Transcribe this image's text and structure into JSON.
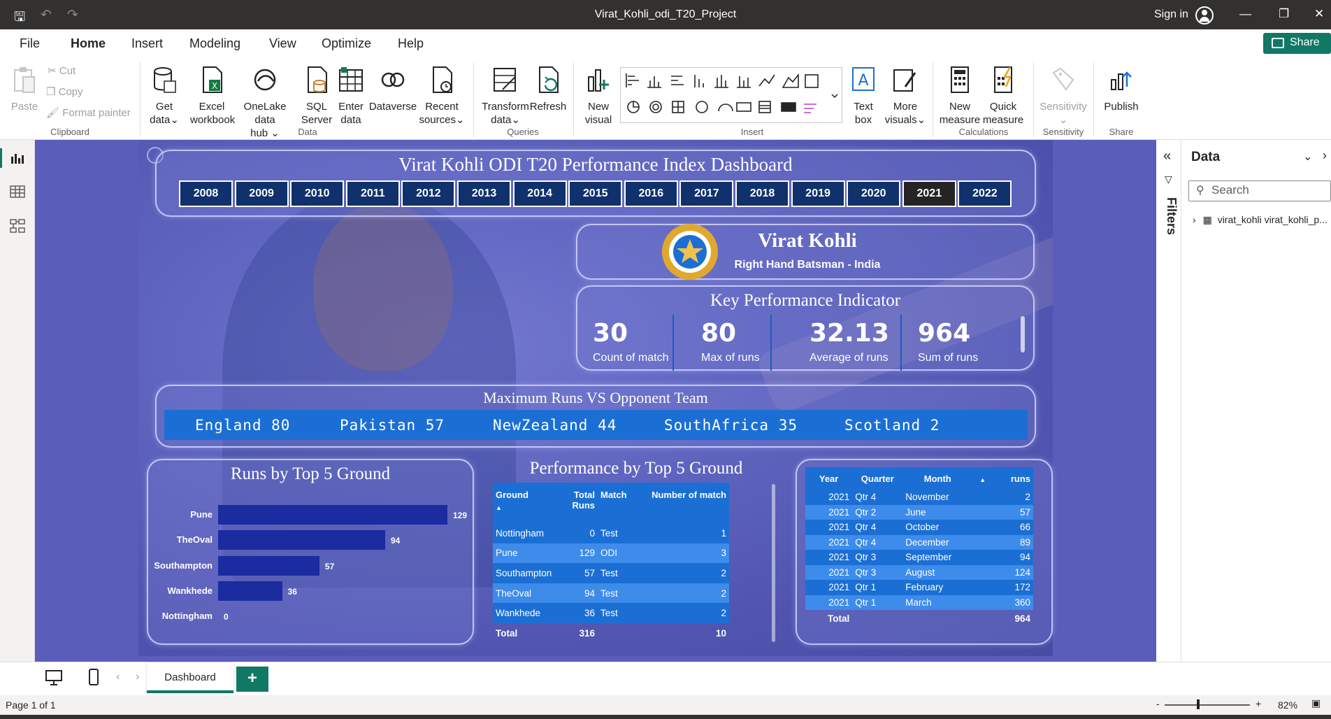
{
  "window": {
    "title": "Virat_Kohli_odi_T20_Project",
    "sign_in": "Sign in"
  },
  "menu": {
    "items": [
      "File",
      "Home",
      "Insert",
      "Modeling",
      "View",
      "Optimize",
      "Help"
    ],
    "share": "Share"
  },
  "ribbon": {
    "clipboard": {
      "paste": "Paste",
      "cut": "Cut",
      "copy": "Copy",
      "format_painter": "Format painter",
      "group": "Clipboard"
    },
    "data": {
      "get_data": [
        "Get",
        "data"
      ],
      "excel": [
        "Excel",
        "workbook"
      ],
      "onelake": [
        "OneLake data",
        "hub"
      ],
      "sql": [
        "SQL",
        "Server"
      ],
      "enter": [
        "Enter",
        "data"
      ],
      "dataverse": "Dataverse",
      "recent": [
        "Recent",
        "sources"
      ],
      "group": "Data"
    },
    "queries": {
      "transform": [
        "Transform",
        "data"
      ],
      "refresh": "Refresh",
      "group": "Queries"
    },
    "insert": {
      "new_visual": [
        "New",
        "visual"
      ],
      "text_box": [
        "Text",
        "box"
      ],
      "more_visuals": [
        "More",
        "visuals"
      ],
      "group": "Insert"
    },
    "calculations": {
      "new_measure": [
        "New",
        "measure"
      ],
      "quick_measure": [
        "Quick",
        "measure"
      ],
      "group": "Calculations"
    },
    "sensitivity": {
      "label": "Sensitivity",
      "group": "Sensitivity"
    },
    "share": {
      "publish": "Publish",
      "group": "Share"
    }
  },
  "dashboard": {
    "title": "Virat Kohli ODI T20 Performance Index Dashboard",
    "years": [
      "2008",
      "2009",
      "2010",
      "2011",
      "2012",
      "2013",
      "2014",
      "2015",
      "2016",
      "2017",
      "2018",
      "2019",
      "2020",
      "2021",
      "2022"
    ],
    "selected_year": "2021",
    "player": {
      "name": "Virat Kohli",
      "role": "Right Hand Batsman - India"
    },
    "kpi": {
      "title": "Key Performance Indicator",
      "items": [
        {
          "value": "30",
          "label": "Count of match"
        },
        {
          "value": "80",
          "label": "Max of runs"
        },
        {
          "value": "32.13",
          "label": "Average of runs"
        },
        {
          "value": "964",
          "label": "Sum of runs"
        }
      ]
    },
    "opponents": {
      "title": "Maximum Runs VS Opponent Team",
      "items": [
        "England 80",
        "Pakistan 57",
        "NewZealand 44",
        "SouthAfrica 35",
        "Scotland 2"
      ]
    },
    "runs_by_ground": {
      "title": "Runs by Top 5 Ground"
    },
    "perf_table": {
      "title": "Performance by Top 5 Ground",
      "headers": [
        "Ground",
        "Total Runs",
        "Match",
        "Number of match"
      ],
      "rows": [
        [
          "Nottingham",
          "0",
          "Test",
          "1"
        ],
        [
          "Pune",
          "129",
          "ODI",
          "3"
        ],
        [
          "Southampton",
          "57",
          "Test",
          "2"
        ],
        [
          "TheOval",
          "94",
          "Test",
          "2"
        ],
        [
          "Wankhede",
          "36",
          "Test",
          "2"
        ]
      ],
      "total": [
        "Total",
        "316",
        "",
        "10"
      ]
    },
    "month_table": {
      "headers": [
        "Year",
        "Quarter",
        "Month",
        "runs"
      ],
      "rows": [
        [
          "2021",
          "Qtr 4",
          "November",
          "2"
        ],
        [
          "2021",
          "Qtr 2",
          "June",
          "57"
        ],
        [
          "2021",
          "Qtr 4",
          "October",
          "66"
        ],
        [
          "2021",
          "Qtr 4",
          "December",
          "89"
        ],
        [
          "2021",
          "Qtr 3",
          "September",
          "94"
        ],
        [
          "2021",
          "Qtr 3",
          "August",
          "124"
        ],
        [
          "2021",
          "Qtr 1",
          "February",
          "172"
        ],
        [
          "2021",
          "Qtr 1",
          "March",
          "360"
        ]
      ],
      "total": [
        "Total",
        "",
        "",
        "964"
      ]
    }
  },
  "chart_data": {
    "type": "bar",
    "title": "Runs by Top 5 Ground",
    "categories": [
      "Pune",
      "TheOval",
      "Southampton",
      "Wankhede",
      "Nottingham"
    ],
    "values": [
      129,
      94,
      57,
      36,
      0
    ],
    "xlim": [
      0,
      129
    ]
  },
  "right_pane": {
    "filters": "Filters",
    "data_title": "Data",
    "search_placeholder": "Search",
    "table_name": "virat_kohli virat_kohli_p..."
  },
  "pages": {
    "active": "Dashboard"
  },
  "status": {
    "page": "Page 1 of 1",
    "zoom": "82%"
  }
}
